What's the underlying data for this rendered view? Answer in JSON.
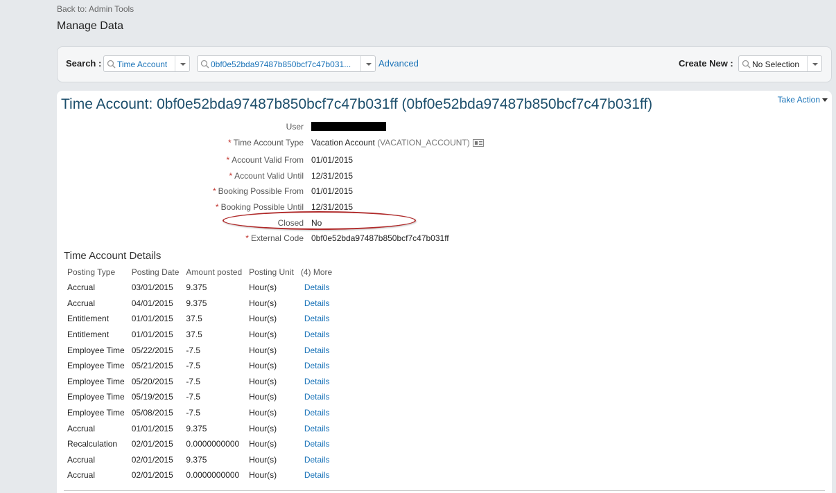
{
  "header": {
    "back_link": "Back to: Admin Tools",
    "title": "Manage Data"
  },
  "search": {
    "label": "Search :",
    "type_value": "Time Account",
    "record_value": "0bf0e52bda97487b850bcf7c47b031...",
    "advanced_label": "Advanced",
    "create_label": "Create New :",
    "create_value": "No Selection"
  },
  "record": {
    "title": "Time Account: 0bf0e52bda97487b850bcf7c47b031ff (0bf0e52bda97487b850bcf7c47b031ff)",
    "take_action": "Take Action",
    "fields": {
      "user_label": "User",
      "type_label": "Time Account Type",
      "type_value": "Vacation Account",
      "type_code": "(VACATION_ACCOUNT)",
      "valid_from_label": "Account Valid From",
      "valid_from_value": "01/01/2015",
      "valid_until_label": "Account Valid Until",
      "valid_until_value": "12/31/2015",
      "booking_from_label": "Booking Possible From",
      "booking_from_value": "01/01/2015",
      "booking_until_label": "Booking Possible Until",
      "booking_until_value": "12/31/2015",
      "closed_label": "Closed",
      "closed_value": "No",
      "external_code_label": "External Code",
      "external_code_value": "0bf0e52bda97487b850bcf7c47b031ff",
      "required_mark": "*"
    }
  },
  "details": {
    "title": "Time Account Details",
    "columns": [
      "Posting Type",
      "Posting Date",
      "Amount posted",
      "Posting Unit",
      "(4) More"
    ],
    "rows": [
      [
        "Accrual",
        "03/01/2015",
        "9.375",
        "Hour(s)",
        "Details"
      ],
      [
        "Accrual",
        "04/01/2015",
        "9.375",
        "Hour(s)",
        "Details"
      ],
      [
        "Entitlement",
        "01/01/2015",
        "37.5",
        "Hour(s)",
        "Details"
      ],
      [
        "Entitlement",
        "01/01/2015",
        "37.5",
        "Hour(s)",
        "Details"
      ],
      [
        "Employee Time",
        "05/22/2015",
        "-7.5",
        "Hour(s)",
        "Details"
      ],
      [
        "Employee Time",
        "05/21/2015",
        "-7.5",
        "Hour(s)",
        "Details"
      ],
      [
        "Employee Time",
        "05/20/2015",
        "-7.5",
        "Hour(s)",
        "Details"
      ],
      [
        "Employee Time",
        "05/19/2015",
        "-7.5",
        "Hour(s)",
        "Details"
      ],
      [
        "Employee Time",
        "05/08/2015",
        "-7.5",
        "Hour(s)",
        "Details"
      ],
      [
        "Accrual",
        "01/01/2015",
        "9.375",
        "Hour(s)",
        "Details"
      ],
      [
        "Recalculation",
        "02/01/2015",
        "0.0000000000",
        "Hour(s)",
        "Details"
      ],
      [
        "Accrual",
        "02/01/2015",
        "9.375",
        "Hour(s)",
        "Details"
      ],
      [
        "Accrual",
        "02/01/2015",
        "0.0000000000",
        "Hour(s)",
        "Details"
      ]
    ]
  },
  "icons": {
    "search": "magnifier-icon",
    "dropdown": "chevron-down-icon",
    "lookup": "value-help-icon"
  },
  "colors": {
    "link": "#1a73b8",
    "title": "#1d4f6c",
    "required": "#c0302a",
    "highlight_ellipse": "#b02a2a"
  }
}
